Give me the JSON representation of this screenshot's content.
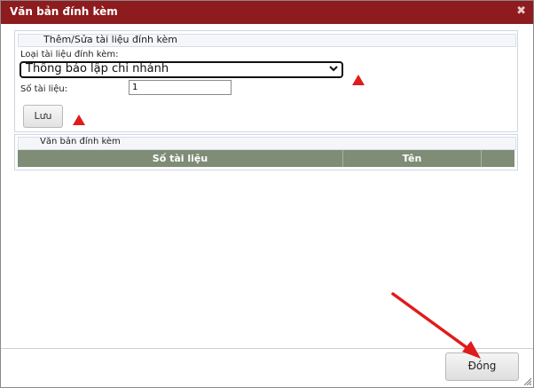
{
  "dialog": {
    "title": "Văn bản đính kèm",
    "close_glyph": "✖"
  },
  "form": {
    "header": "Thêm/Sửa tài liệu đính kèm",
    "doc_type_label": "Loại tài liệu đính kèm:",
    "doc_type_value": "Thông báo lập chi nhánh",
    "doc_number_label": "Số tài liệu:",
    "doc_number_value": "1",
    "save_label": "Lưu"
  },
  "attachments": {
    "header": "Văn bản đính kèm",
    "columns": [
      "Số tài liệu",
      "Tên",
      ""
    ]
  },
  "footer": {
    "close_label": "Đóng"
  },
  "colors": {
    "titlebar": "#8e1b1e",
    "table_header": "#7f8c76",
    "annotation": "#e01b1b"
  },
  "icons": {
    "close": "close-icon",
    "dropdown": "chevron-down-icon",
    "resize": "resize-grip-icon"
  }
}
